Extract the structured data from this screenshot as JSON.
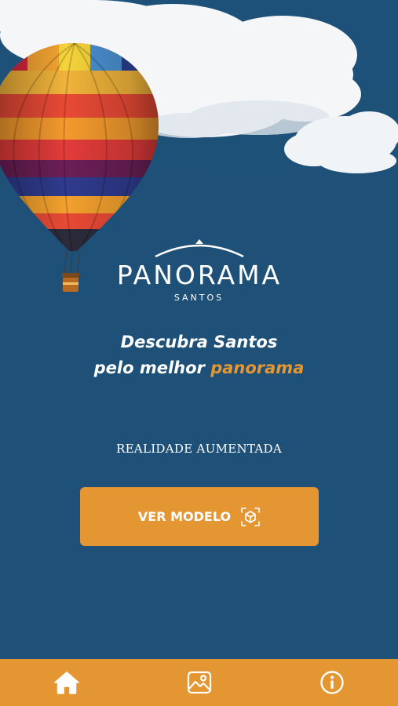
{
  "brand": {
    "name": "PANORAMA",
    "subtitle": "SANTOS"
  },
  "tagline": {
    "line1": "Descubra Santos",
    "line2_prefix": "pelo melhor ",
    "line2_accent": "panorama"
  },
  "section": {
    "label": "REALIDADE AUMENTADA"
  },
  "cta": {
    "label": "VER MODELO",
    "icon": "ar-cube-icon"
  },
  "nav": {
    "items": [
      {
        "id": "home",
        "icon": "home-icon",
        "active": true
      },
      {
        "id": "gallery",
        "icon": "image-icon",
        "active": false
      },
      {
        "id": "info",
        "icon": "info-icon",
        "active": false
      }
    ]
  },
  "colors": {
    "background": "#1f5178",
    "accent": "#e49633",
    "text": "#ffffff"
  }
}
